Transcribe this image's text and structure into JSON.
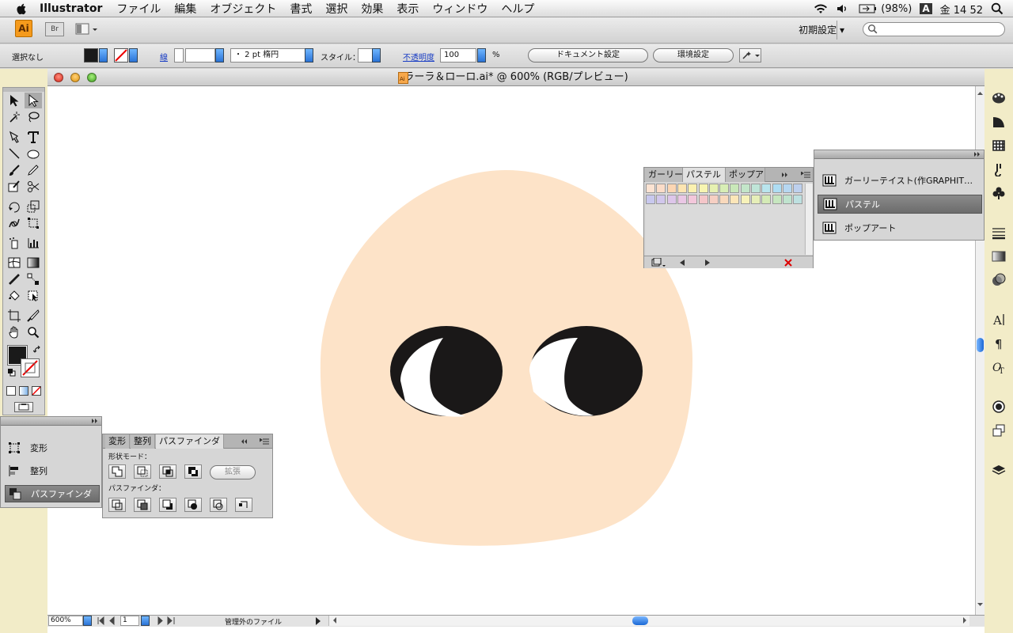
{
  "menubar": {
    "app_name": "Illustrator",
    "menus": [
      "ファイル",
      "編集",
      "オブジェクト",
      "書式",
      "選択",
      "効果",
      "表示",
      "ウィンドウ",
      "ヘルプ"
    ],
    "battery": "(98%)",
    "input_method": "A",
    "clock": "金 14 52"
  },
  "appbar": {
    "ai_logo": "Ai",
    "bridge_label": "Br",
    "workspace_label": "初期設定 ▾"
  },
  "control": {
    "selection_label": "選択なし",
    "stroke_label": "線",
    "stroke_weight": "",
    "brush_value": "・  2 pt 楕円",
    "style_label": "スタイル：",
    "opacity_label": "不透明度",
    "opacity_value": "100",
    "percent": "%",
    "document_settings": "ドキュメント設定",
    "preferences": "環境設定"
  },
  "document": {
    "title": "ラーラ＆ローロ.ai* @ 600% (RGB/プレビュー)",
    "zoom": "600%",
    "artboard": "1",
    "status_text": "管理外のファイル",
    "face_color": "#FDE3C8",
    "eye_color": "#1A1818"
  },
  "swatch_panel": {
    "tabs": [
      "ガーリー",
      "パステル",
      "ポップア"
    ],
    "row1": [
      "#FCE3D2",
      "#FBDCC8",
      "#FCD6B3",
      "#FDE5B1",
      "#FBF1B0",
      "#F7F5B1",
      "#E6F1B1",
      "#D8EEB5",
      "#C9E8B9",
      "#C3E6C9",
      "#BFE5D8",
      "#B9E5EE",
      "#AEDDF3",
      "#B6D7F1",
      "#BDD0EE"
    ],
    "row2": [
      "#C8C8EE",
      "#D1C7EC",
      "#DDC6EA",
      "#EAC7E5",
      "#F3C7DB",
      "#F4C6C9",
      "#F6CFC3",
      "#F9D9BC",
      "#FCE6B8",
      "#F7F2B9",
      "#E6EEB8",
      "#D4EAB6",
      "#C6E6BF",
      "#BFE3CE",
      "#BDE0E0"
    ]
  },
  "library_panel": {
    "items": [
      "ガーリーテイスト(作GRAPHIT…",
      "パステル",
      "ポップアート"
    ]
  },
  "transform_panel": {
    "items": [
      "変形",
      "整列",
      "パスファインダ"
    ]
  },
  "pathfinder_panel": {
    "tabs": [
      "変形",
      "整列",
      "パスファインダ"
    ],
    "shape_modes_label": "形状モード：",
    "expand_label": "拡張",
    "pathfinder_label": "パスファインダ："
  }
}
